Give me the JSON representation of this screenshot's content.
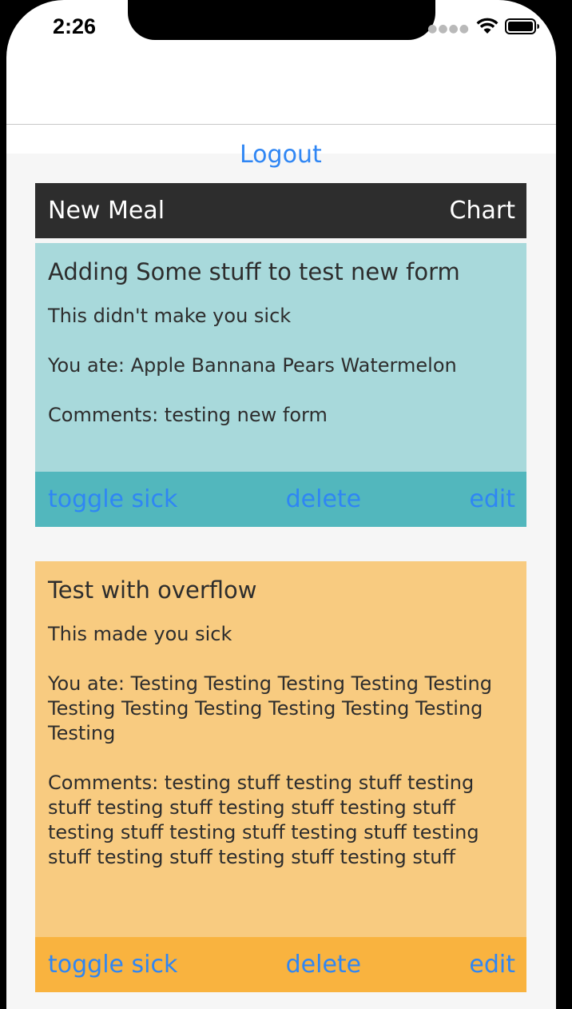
{
  "status_bar": {
    "time": "2:26"
  },
  "logout_label": "Logout",
  "topbar": {
    "new_meal_label": "New Meal",
    "chart_label": "Chart"
  },
  "meals": [
    {
      "title": "Adding Some stuff to test new form",
      "sick_status": "This didn't make you sick",
      "ate": "You ate: Apple Bannana Pears Watermelon",
      "comments": "Comments: testing new form",
      "toggle_label": "toggle sick",
      "delete_label": "delete",
      "edit_label": "edit",
      "body_color": "#a8d9db",
      "action_color": "#52b7bd"
    },
    {
      "title": "Test with overflow",
      "sick_status": "This made you sick",
      "ate": "You ate: Testing Testing Testing Testing Testing Testing Testing Testing Testing Testing Testing Testing",
      "comments": "Comments: testing stuff testing stuff testing stuff testing stuff testing stuff testing stuff testing stuff testing stuff testing stuff testing stuff testing stuff testing stuff testing stuff",
      "toggle_label": "toggle sick",
      "delete_label": "delete",
      "edit_label": "edit",
      "body_color": "#f8cb80",
      "action_color": "#f9b33f"
    }
  ],
  "colors": {
    "link": "#2f86f4",
    "topbar": "#2d2d2d",
    "background": "#f6f6f6"
  },
  "icons": [
    "cellular-signal-icon",
    "wifi-icon",
    "battery-icon"
  ]
}
